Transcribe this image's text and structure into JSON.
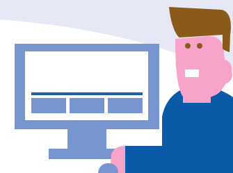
{
  "illustration": {
    "colors": {
      "background": "#ffffff",
      "background_swoosh": "#e6e8f5",
      "monitor_frame": "#7795cf",
      "monitor_screen": "#ffffff",
      "screen_bar": "#1f5fa6",
      "screen_tile": "#7795cf",
      "person_skin": "#f8a3c9",
      "person_hair": "#8a5a19",
      "person_eye": "#8a5a19",
      "person_shirt": "#0b5aa7",
      "person_teeth": "#ffffff"
    },
    "icons": {
      "monitor": "computer-monitor-icon",
      "person": "person-at-computer"
    },
    "screen_tiles_count": 3
  }
}
